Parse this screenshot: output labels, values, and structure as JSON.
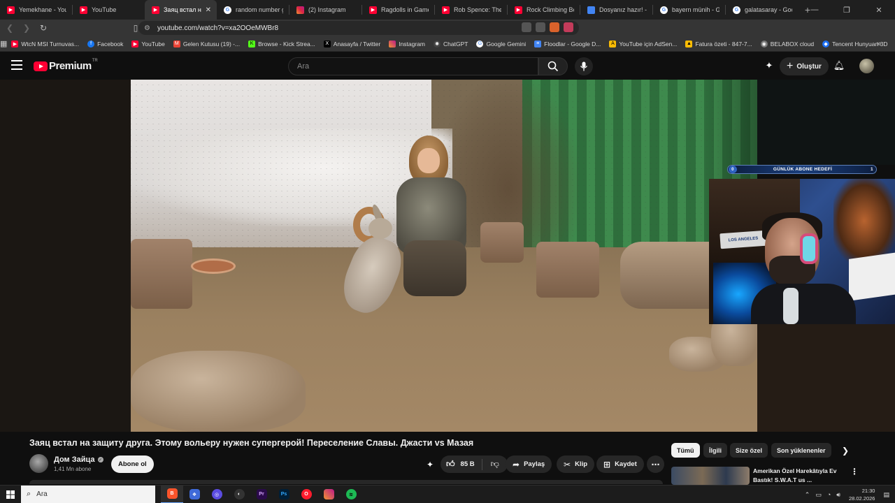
{
  "browser": {
    "tabs": [
      {
        "title": "Yemekhane - YouTu",
        "icon": "youtube-favicon"
      },
      {
        "title": "YouTube",
        "icon": "youtube-favicon"
      },
      {
        "title": "Заяц встал на",
        "icon": "youtube-favicon",
        "active": true
      },
      {
        "title": "random number ge",
        "icon": "google-favicon"
      },
      {
        "title": "(2) Instagram",
        "icon": "instagram-favicon"
      },
      {
        "title": "Ragdolls in Games",
        "icon": "youtube-favicon"
      },
      {
        "title": "Rob Spence: The be",
        "icon": "youtube-favicon"
      },
      {
        "title": "Rock Climbing Bear",
        "icon": "youtube-favicon"
      },
      {
        "title": "Dosyanız hazır! - Yo",
        "icon": "document-favicon"
      },
      {
        "title": "bayern münih - Goo",
        "icon": "google-favicon"
      },
      {
        "title": "galatasaray - Googl",
        "icon": "google-favicon"
      }
    ],
    "url": "youtube.com/watch?v=xa2OOeMWBr8",
    "bookmarks": [
      {
        "label": "WtcN MSI Turnuvas...",
        "icon": "youtube-favicon"
      },
      {
        "label": "Facebook",
        "icon": "facebook-favicon"
      },
      {
        "label": "YouTube",
        "icon": "youtube-favicon"
      },
      {
        "label": "Gelen Kutusu (19) -...",
        "icon": "gmail-favicon"
      },
      {
        "label": "Browse - Kick Strea...",
        "icon": "kick-favicon"
      },
      {
        "label": "Anasayfa / Twitter",
        "icon": "x-favicon"
      },
      {
        "label": "Instagram",
        "icon": "instagram-favicon"
      },
      {
        "label": "ChatGPT",
        "icon": "chatgpt-favicon"
      },
      {
        "label": "Google Gemini",
        "icon": "gemini-favicon"
      },
      {
        "label": "Floodlar - Google D...",
        "icon": "docs-favicon"
      },
      {
        "label": "YouTube için AdSen...",
        "icon": "adsense-favicon"
      },
      {
        "label": "Fatura özeti - 847-7...",
        "icon": "ads-favicon"
      },
      {
        "label": "BELABOX cloud",
        "icon": "belabox-favicon"
      },
      {
        "label": "Tencent Hunyuan 3D",
        "icon": "tencent-favicon"
      }
    ]
  },
  "youtube": {
    "logo_text": "Premium",
    "logo_region": "TR",
    "search_placeholder": "Ara",
    "create_label": "Oluştur"
  },
  "overlay": {
    "goal_label": "GÜNLÜK ABONE HEDEFİ",
    "goal_current": "0",
    "goal_target": "1",
    "sign_text": "LOS ANGELES"
  },
  "video": {
    "title": "Заяц встал на защиту друга. Этому вольеру нужен супергерой! Переселение Славы. Джасти vs Мазая",
    "channel_name": "Дом Зайца",
    "subscribers": "1,41 Mn abone",
    "subscribe_label": "Abone ol",
    "likes": "85 B",
    "share_label": "Paylaş",
    "clip_label": "Klip",
    "save_label": "Kaydet"
  },
  "chips": [
    "Tümü",
    "İlgili",
    "Size özel",
    "Son yüklenenler"
  ],
  "suggested": {
    "title": "Amerikan Özel Harekâtıyla Ev Bastık! S.W.A.T us ..."
  },
  "taskbar": {
    "search_placeholder": "Ara",
    "time": "21:30",
    "date": "28.02.2026"
  }
}
